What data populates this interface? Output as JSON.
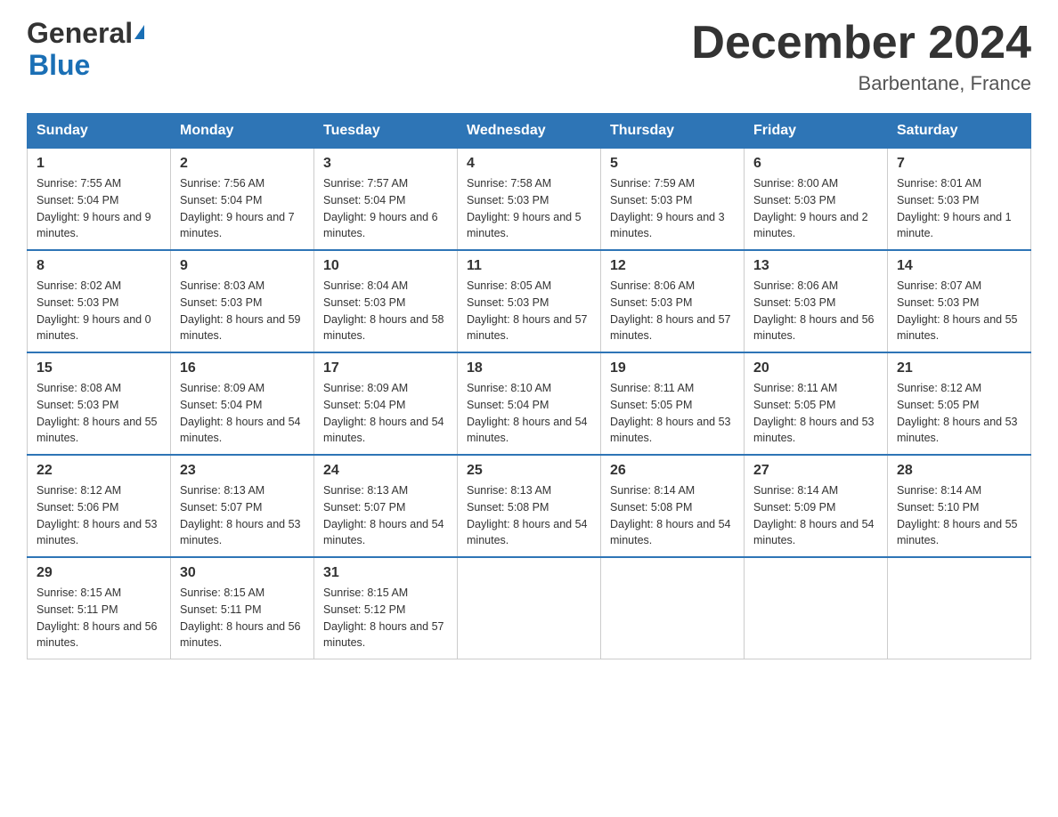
{
  "header": {
    "logo_general": "General",
    "logo_blue": "Blue",
    "title": "December 2024",
    "subtitle": "Barbentane, France"
  },
  "days_of_week": [
    "Sunday",
    "Monday",
    "Tuesday",
    "Wednesday",
    "Thursday",
    "Friday",
    "Saturday"
  ],
  "weeks": [
    [
      {
        "day": "1",
        "sunrise": "7:55 AM",
        "sunset": "5:04 PM",
        "daylight": "9 hours and 9 minutes."
      },
      {
        "day": "2",
        "sunrise": "7:56 AM",
        "sunset": "5:04 PM",
        "daylight": "9 hours and 7 minutes."
      },
      {
        "day": "3",
        "sunrise": "7:57 AM",
        "sunset": "5:04 PM",
        "daylight": "9 hours and 6 minutes."
      },
      {
        "day": "4",
        "sunrise": "7:58 AM",
        "sunset": "5:03 PM",
        "daylight": "9 hours and 5 minutes."
      },
      {
        "day": "5",
        "sunrise": "7:59 AM",
        "sunset": "5:03 PM",
        "daylight": "9 hours and 3 minutes."
      },
      {
        "day": "6",
        "sunrise": "8:00 AM",
        "sunset": "5:03 PM",
        "daylight": "9 hours and 2 minutes."
      },
      {
        "day": "7",
        "sunrise": "8:01 AM",
        "sunset": "5:03 PM",
        "daylight": "9 hours and 1 minute."
      }
    ],
    [
      {
        "day": "8",
        "sunrise": "8:02 AM",
        "sunset": "5:03 PM",
        "daylight": "9 hours and 0 minutes."
      },
      {
        "day": "9",
        "sunrise": "8:03 AM",
        "sunset": "5:03 PM",
        "daylight": "8 hours and 59 minutes."
      },
      {
        "day": "10",
        "sunrise": "8:04 AM",
        "sunset": "5:03 PM",
        "daylight": "8 hours and 58 minutes."
      },
      {
        "day": "11",
        "sunrise": "8:05 AM",
        "sunset": "5:03 PM",
        "daylight": "8 hours and 57 minutes."
      },
      {
        "day": "12",
        "sunrise": "8:06 AM",
        "sunset": "5:03 PM",
        "daylight": "8 hours and 57 minutes."
      },
      {
        "day": "13",
        "sunrise": "8:06 AM",
        "sunset": "5:03 PM",
        "daylight": "8 hours and 56 minutes."
      },
      {
        "day": "14",
        "sunrise": "8:07 AM",
        "sunset": "5:03 PM",
        "daylight": "8 hours and 55 minutes."
      }
    ],
    [
      {
        "day": "15",
        "sunrise": "8:08 AM",
        "sunset": "5:03 PM",
        "daylight": "8 hours and 55 minutes."
      },
      {
        "day": "16",
        "sunrise": "8:09 AM",
        "sunset": "5:04 PM",
        "daylight": "8 hours and 54 minutes."
      },
      {
        "day": "17",
        "sunrise": "8:09 AM",
        "sunset": "5:04 PM",
        "daylight": "8 hours and 54 minutes."
      },
      {
        "day": "18",
        "sunrise": "8:10 AM",
        "sunset": "5:04 PM",
        "daylight": "8 hours and 54 minutes."
      },
      {
        "day": "19",
        "sunrise": "8:11 AM",
        "sunset": "5:05 PM",
        "daylight": "8 hours and 53 minutes."
      },
      {
        "day": "20",
        "sunrise": "8:11 AM",
        "sunset": "5:05 PM",
        "daylight": "8 hours and 53 minutes."
      },
      {
        "day": "21",
        "sunrise": "8:12 AM",
        "sunset": "5:05 PM",
        "daylight": "8 hours and 53 minutes."
      }
    ],
    [
      {
        "day": "22",
        "sunrise": "8:12 AM",
        "sunset": "5:06 PM",
        "daylight": "8 hours and 53 minutes."
      },
      {
        "day": "23",
        "sunrise": "8:13 AM",
        "sunset": "5:07 PM",
        "daylight": "8 hours and 53 minutes."
      },
      {
        "day": "24",
        "sunrise": "8:13 AM",
        "sunset": "5:07 PM",
        "daylight": "8 hours and 54 minutes."
      },
      {
        "day": "25",
        "sunrise": "8:13 AM",
        "sunset": "5:08 PM",
        "daylight": "8 hours and 54 minutes."
      },
      {
        "day": "26",
        "sunrise": "8:14 AM",
        "sunset": "5:08 PM",
        "daylight": "8 hours and 54 minutes."
      },
      {
        "day": "27",
        "sunrise": "8:14 AM",
        "sunset": "5:09 PM",
        "daylight": "8 hours and 54 minutes."
      },
      {
        "day": "28",
        "sunrise": "8:14 AM",
        "sunset": "5:10 PM",
        "daylight": "8 hours and 55 minutes."
      }
    ],
    [
      {
        "day": "29",
        "sunrise": "8:15 AM",
        "sunset": "5:11 PM",
        "daylight": "8 hours and 56 minutes."
      },
      {
        "day": "30",
        "sunrise": "8:15 AM",
        "sunset": "5:11 PM",
        "daylight": "8 hours and 56 minutes."
      },
      {
        "day": "31",
        "sunrise": "8:15 AM",
        "sunset": "5:12 PM",
        "daylight": "8 hours and 57 minutes."
      },
      null,
      null,
      null,
      null
    ]
  ],
  "labels": {
    "sunrise": "Sunrise:",
    "sunset": "Sunset:",
    "daylight": "Daylight:"
  }
}
